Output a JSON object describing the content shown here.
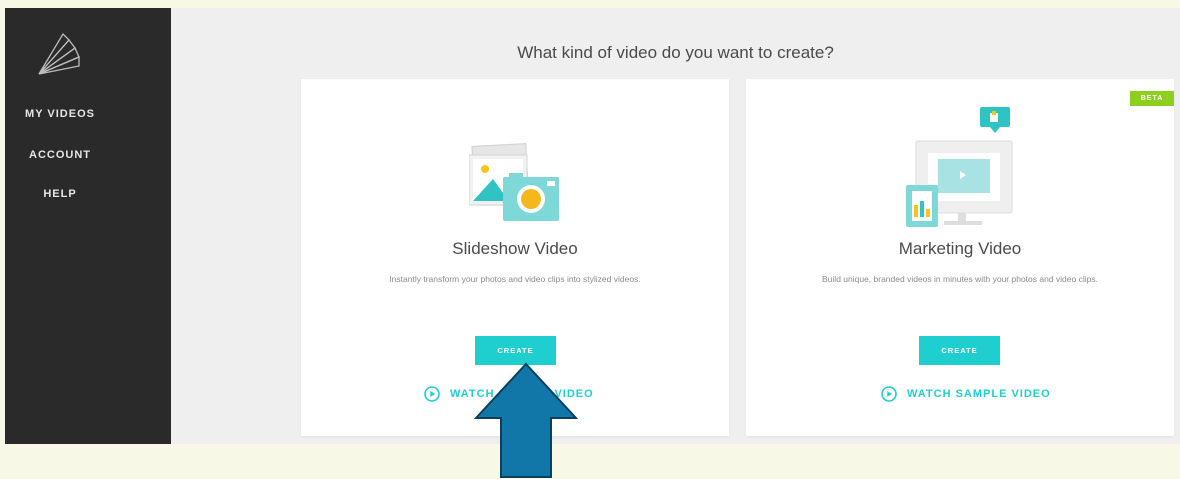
{
  "sidebar": {
    "logo": "fan-logo-icon",
    "items": [
      {
        "label": "MY VIDEOS"
      },
      {
        "label": "ACCOUNT"
      },
      {
        "label": "HELP"
      }
    ]
  },
  "main": {
    "heading": "What kind of video do you want to create?",
    "cards": [
      {
        "title": "Slideshow Video",
        "description": "Instantly transform your photos and video clips into stylized videos.",
        "create_label": "CREATE",
        "watch_label": "WATCH SAMPLE VIDEO",
        "icon": "photo-camera-icon"
      },
      {
        "title": "Marketing Video",
        "description": "Build unique, branded videos in minutes with your photos and video clips.",
        "create_label": "CREATE",
        "watch_label": "WATCH SAMPLE VIDEO",
        "badge": "BETA",
        "icon": "monitor-marketing-icon"
      }
    ]
  },
  "overlay": {
    "arrow": "up-arrow-annotation",
    "arrow_color": "#1177a8"
  },
  "colors": {
    "accent": "#1fcfcf",
    "beta": "#8ccf1c",
    "sidebar": "#2a2a2a",
    "page_background": "#f7f8e6"
  }
}
